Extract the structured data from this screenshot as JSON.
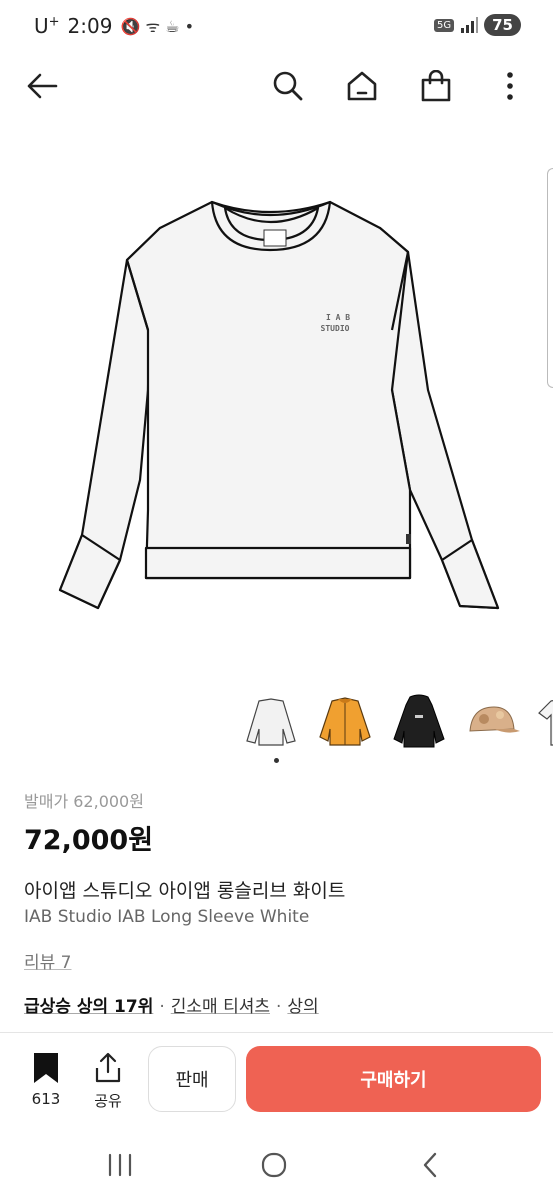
{
  "status_bar": {
    "carrier": "U",
    "carrier_sup": "+",
    "time": "2:09",
    "icons_text": "🔇 ᯤ ☕ •",
    "network": "5G",
    "battery": "75"
  },
  "nav": {
    "icons": [
      "back-arrow-icon",
      "search-icon",
      "home-icon",
      "shopping-bag-icon",
      "more-vertical-icon"
    ]
  },
  "product": {
    "logo_line1": "I A B",
    "logo_line2": "STUDIO",
    "release_price": "발매가 62,000원",
    "price": "72,000원",
    "name_ko": "아이앱 스튜디오 아이앱 롱슬리브 화이트",
    "name_en": "IAB Studio IAB Long Sleeve White",
    "review": "리뷰 7",
    "rank": {
      "highlight": "급상승 상의 17위",
      "sep": "·",
      "category1": "긴소매 티셔츠",
      "category2": "상의"
    }
  },
  "thumbnails": [
    {
      "name": "white-longsleeve",
      "color": "#f2f2f2"
    },
    {
      "name": "orange-jacket",
      "color": "#f0a030"
    },
    {
      "name": "black-hoodie",
      "color": "#1f1f1f"
    },
    {
      "name": "camo-cap",
      "color": "#d9b08a"
    },
    {
      "name": "white-tee",
      "color": "#f5f5f5"
    }
  ],
  "actions": {
    "wish_count": "613",
    "share_label": "공유",
    "sell_label": "판매",
    "buy_label": "구매하기",
    "buy_color": "#ef6253"
  }
}
